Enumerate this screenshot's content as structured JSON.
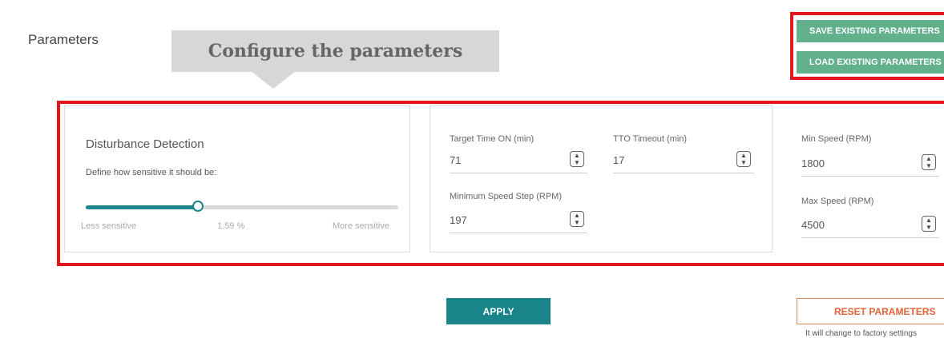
{
  "page": {
    "title": "Parameters",
    "callout": "Configure the parameters"
  },
  "actions": {
    "save_label": "SAVE EXISTING PARAMETERS",
    "load_label": "LOAD EXISTING PARAMETERS"
  },
  "disturbance": {
    "title": "Disturbance Detection",
    "subtitle": "Define how sensitive it should be:",
    "slider_fraction": 0.36,
    "label_left": "Less sensitive",
    "value": "1.59 %",
    "label_right": "More sensitive"
  },
  "timing": {
    "target_time_label": "Target Time ON (min)",
    "target_time_value": "71",
    "tto_label": "TTO Timeout (min)",
    "tto_value": "17",
    "min_step_label": "Minimum Speed Step (RPM)",
    "min_step_value": "197"
  },
  "speed": {
    "min_label": "Min Speed (RPM)",
    "min_value": "1800",
    "max_label": "Max Speed (RPM)",
    "max_value": "4500"
  },
  "footer": {
    "apply_label": "APPLY",
    "reset_label": "RESET PARAMETERS",
    "reset_note": "It will change to factory settings"
  },
  "icons": {
    "spinner": "up-down-arrows-icon"
  },
  "colors": {
    "accent_teal": "#19858b",
    "accent_green": "#62b08c",
    "highlight_red": "#e3161d",
    "reset_orange": "#e0633a"
  }
}
